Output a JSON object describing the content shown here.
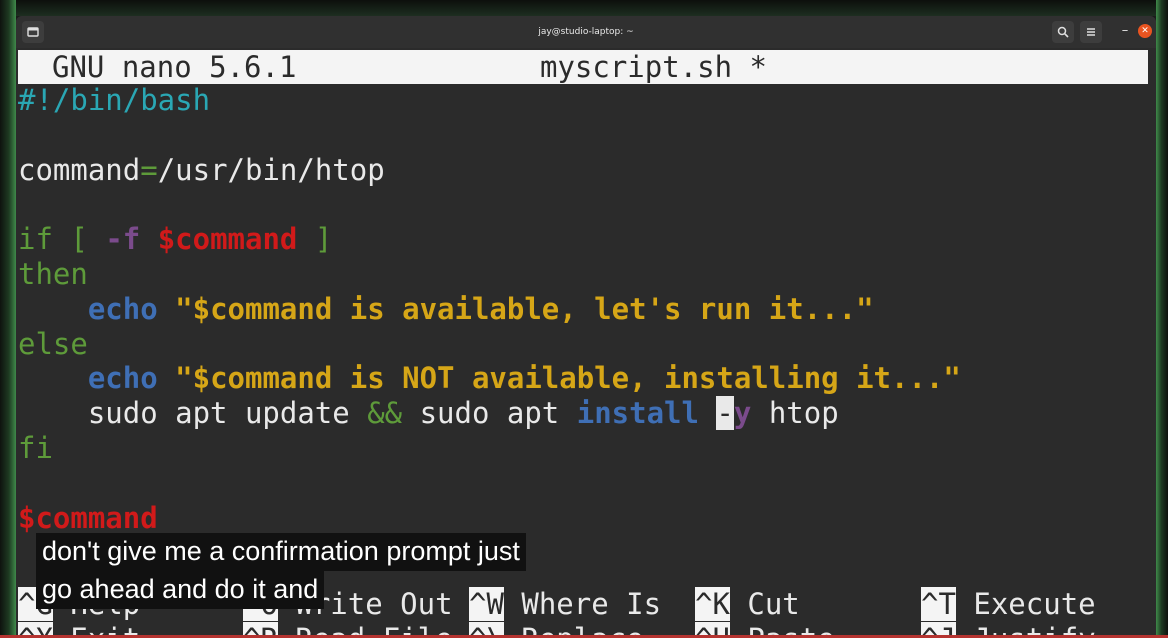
{
  "window": {
    "title": "jay@studio-laptop: ~",
    "buttons": {
      "new_tab_icon": "terminal-plus-icon",
      "search_icon": "search-icon",
      "menu_icon": "hamburger-menu-icon",
      "minimize": "–",
      "close": "✕"
    }
  },
  "nano": {
    "version": "GNU nano 5.6.1",
    "filename": "myscript.sh *"
  },
  "code": {
    "l1": "#!/bin/bash",
    "l3a": "command",
    "l3b": "=",
    "l3c": "/usr/bin/htop",
    "l5a": "if [ ",
    "l5b": "-f",
    "l5c": " ",
    "l5d": "$command",
    "l5e": " ]",
    "l6": "then",
    "l7a": "    ",
    "l7b": "echo",
    "l7c": " \"$command is available, let's run it...\"",
    "l8": "else",
    "l9a": "    ",
    "l9b": "echo",
    "l9c": " \"$command is NOT available, installing it...\"",
    "l10a": "    sudo apt update ",
    "l10b": "&&",
    "l10c": " sudo apt ",
    "l10d": "install",
    "l10e": " ",
    "l10f": "-",
    "l10g": "y",
    "l10h": " htop",
    "l11": "fi",
    "l13": "$command"
  },
  "shortcuts": [
    {
      "key": "^G",
      "label": "Help"
    },
    {
      "key": "^O",
      "label": "Write Out"
    },
    {
      "key": "^W",
      "label": "Where Is"
    },
    {
      "key": "^K",
      "label": "Cut"
    },
    {
      "key": "^T",
      "label": "Execute"
    },
    {
      "key": "^X",
      "label": "Exit"
    },
    {
      "key": "^R",
      "label": "Read File"
    },
    {
      "key": "^\\",
      "label": "Replace"
    },
    {
      "key": "^U",
      "label": "Paste"
    },
    {
      "key": "^J",
      "label": "Justify"
    }
  ],
  "captions": {
    "line1": "don't give me a confirmation prompt just",
    "line2": "go ahead and do it and"
  }
}
